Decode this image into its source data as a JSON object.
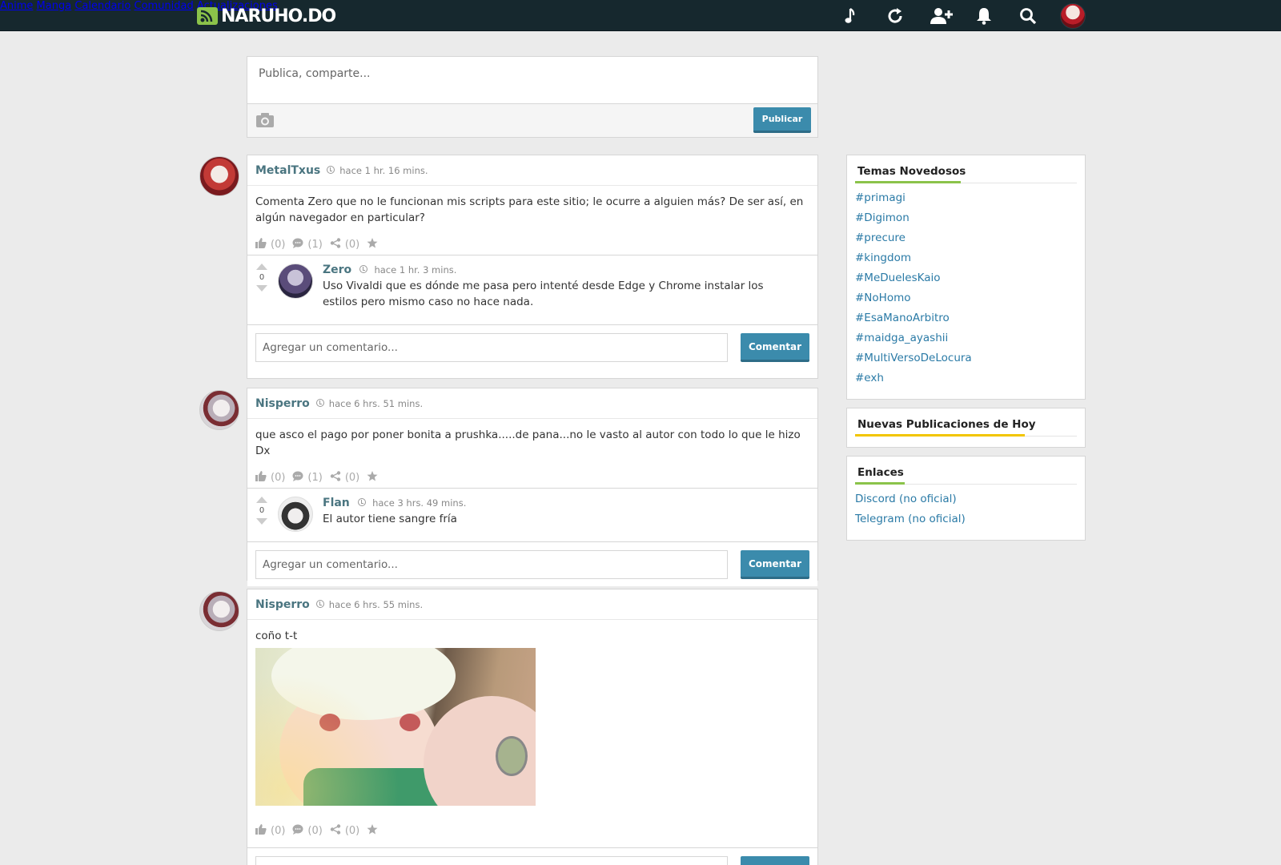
{
  "header": {
    "logo_text": "NARUHO.DO",
    "nav": [
      "Anime",
      "Manga",
      "Calendario",
      "Comunidad",
      "Actualizaciones"
    ]
  },
  "publish": {
    "placeholder": "Publica, comparte...",
    "button": "Publicar"
  },
  "posts": [
    {
      "user": "MetalTxus",
      "time": "hace 1 hr. 16 mins.",
      "text": "Comenta Zero que no le funcionan mis scripts para este sitio; le ocurre a alguien más? De ser así, en algún navegador en particular?",
      "likes": "(0)",
      "comments": "(1)",
      "shares": "(0)",
      "reply": {
        "user": "Zero",
        "time": "hace 1 hr. 3 mins.",
        "votes": "0",
        "text": "Uso Vivaldi que es dónde me pasa pero intenté desde Edge y Chrome instalar los estilos pero mismo caso no hace nada."
      },
      "comment_placeholder": "Agregar un comentario...",
      "comment_button": "Comentar"
    },
    {
      "user": "Nisperro",
      "time": "hace 6 hrs. 51 mins.",
      "text": "que asco el pago por poner bonita a prushka.....de pana...no le vasto al autor con todo lo que le hizo Dx",
      "likes": "(0)",
      "comments": "(1)",
      "shares": "(0)",
      "reply": {
        "user": "Flan",
        "time": "hace 3 hrs. 49 mins.",
        "votes": "0",
        "text": "El autor tiene sangre fría"
      },
      "comment_placeholder": "Agregar un comentario...",
      "comment_button": "Comentar"
    },
    {
      "user": "Nisperro",
      "time": "hace 6 hrs. 55 mins.",
      "text": "coño t-t",
      "likes": "(0)",
      "comments": "(0)",
      "shares": "(0)"
    }
  ],
  "sidebar": {
    "trending_title": "Temas Novedosos",
    "tags": [
      "#primagi",
      "#Digimon",
      "#precure",
      "#kingdom",
      "#MeDuelesKaio",
      "#NoHomo",
      "#EsaManoArbitro",
      "#maidga_ayashii",
      "#MultiVersoDeLocura",
      "#exh"
    ],
    "new_posts_title": "Nuevas Publicaciones de Hoy",
    "links_title": "Enlaces",
    "links": [
      "Discord (no oficial)",
      "Telegram (no oficial)"
    ]
  },
  "colors": {
    "topbar": "#16282e",
    "accent_button": "#3b8bac",
    "username": "#4a7580",
    "link": "#2a7aa6",
    "underline_green": "#8bc34a",
    "underline_yellow": "#f2c500"
  }
}
